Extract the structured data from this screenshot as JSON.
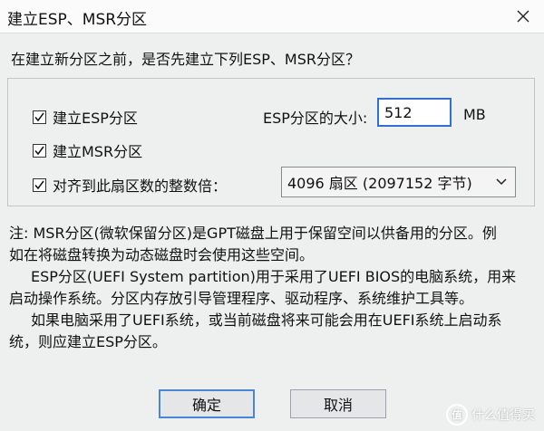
{
  "window": {
    "title": "建立ESP、MSR分区",
    "close_icon": "close-icon"
  },
  "question": "在建立新分区之前，是否先建立下列ESP、MSR分区？",
  "options": [
    {
      "label": "建立ESP分区",
      "checked": true
    },
    {
      "label": "建立MSR分区",
      "checked": true
    },
    {
      "label": "对齐到此扇区数的整数倍：",
      "checked": true
    }
  ],
  "esp_size": {
    "label": "ESP分区的大小:",
    "value": "512",
    "unit": "MB"
  },
  "alignment": {
    "selected": "4096 扇区 (2097152 字节)"
  },
  "note": {
    "line1": "注: MSR分区(微软保留分区)是GPT磁盘上用于保留空间以供备用的分区。例",
    "line2": "如在将磁盘转换为动态磁盘时会使用这些空间。",
    "line3": "ESP分区(UEFI System partition)用于采用了UEFI BIOS的电脑系统，用来",
    "line4": "启动操作系统。分区内存放引导管理程序、驱动程序、系统维护工具等。",
    "line5": "如果电脑采用了UEFI系统，或当前磁盘将来可能会用在UEFI系统上启动系",
    "line6": "统，则应建立ESP分区。"
  },
  "buttons": {
    "ok": "确定",
    "cancel": "取消"
  },
  "watermark": {
    "logo": "值",
    "text": "什么值得买"
  }
}
